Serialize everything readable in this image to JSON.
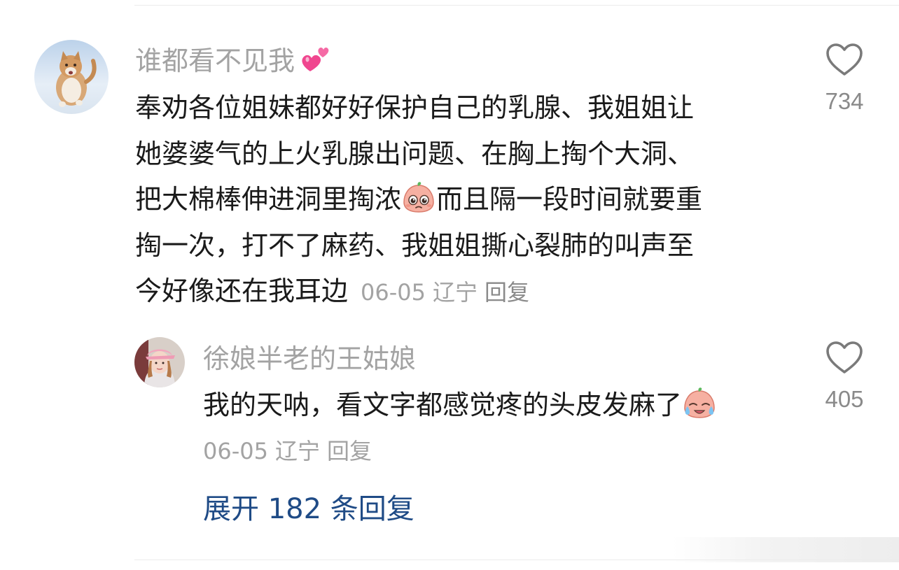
{
  "comment": {
    "username": "谁都看不见我",
    "username_emoji": "two-hearts-emoji",
    "lines_before_emoji": [
      "奉劝各位姐妹都好好保护自己的乳腺、我姐姐让",
      "她婆婆气的上火乳腺出问题、在胸上掏个大洞、"
    ],
    "line3_before_emoji": "把大棉棒伸进洞里掏浓",
    "inline_emoji": "pleading-face-emoji",
    "line3_after_emoji": "而且隔一段时间就要重",
    "line4": "掏一次，打不了麻药、我姐姐撕心裂肺的叫声至",
    "line5": "今好像还在我耳边",
    "date": "06-05",
    "location": "辽宁",
    "reply_label": "回复",
    "like_count": "734"
  },
  "reply": {
    "username": "徐娘半老的王姑娘",
    "text": "我的天呐，看文字都感觉疼的头皮发麻了",
    "inline_emoji": "crying-face-emoji",
    "date": "06-05",
    "location": "辽宁",
    "reply_label": "回复",
    "like_count": "405"
  },
  "expand_label": "展开 182 条回复",
  "colors": {
    "text": "#1a1a1a",
    "meta": "#a3a3a3",
    "link": "#1f4b86",
    "emoji_pink": "#f79a8c"
  }
}
